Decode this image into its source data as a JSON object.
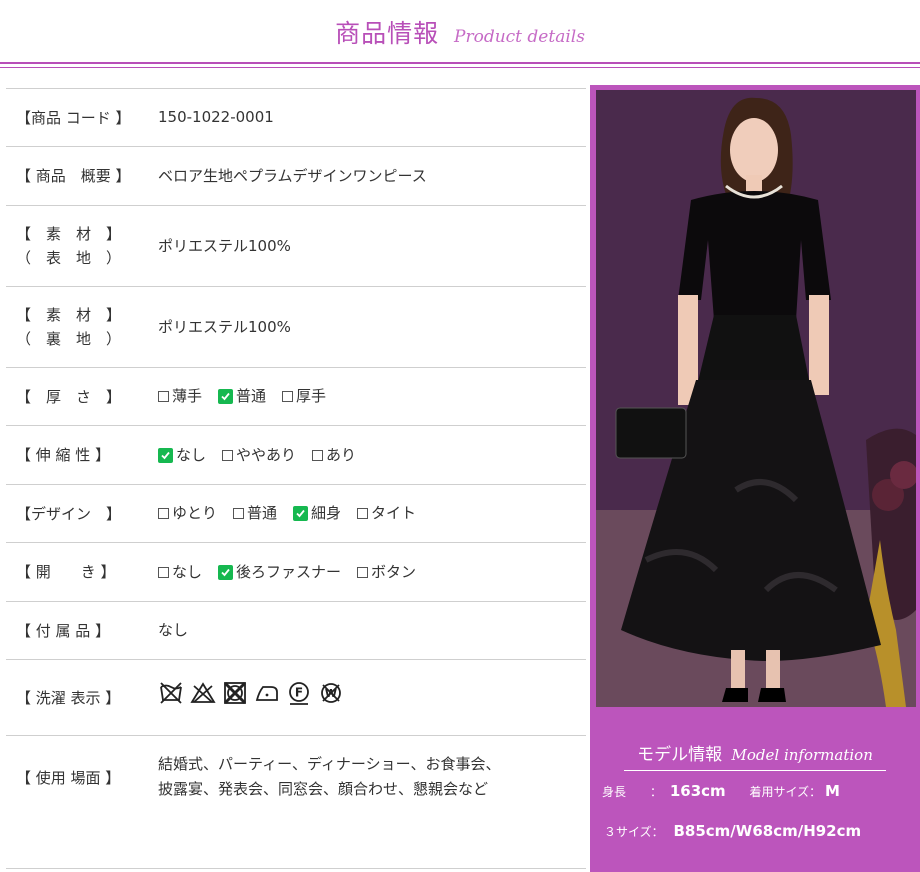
{
  "header": {
    "title_jp": "商品情報",
    "title_en": "Product details"
  },
  "rows": [
    {
      "label": [
        "【商品 コード 】"
      ],
      "value": "150-1022-0001"
    },
    {
      "label": [
        "【 商品　概要 】"
      ],
      "value": "ベロア生地ペプラムデザインワンピース"
    },
    {
      "label": [
        "【　素　材　】",
        "（　表　地　）"
      ],
      "value": "ポリエステル100%"
    },
    {
      "label": [
        "【　素　材　】",
        "（　裏　地　）"
      ],
      "value": "ポリエステル100%"
    },
    {
      "label": [
        "【　厚　さ　】"
      ],
      "options": [
        {
          "text": "薄手",
          "checked": false
        },
        {
          "text": "普通",
          "checked": true
        },
        {
          "text": "厚手",
          "checked": false
        }
      ]
    },
    {
      "label": [
        "【 伸 縮 性 】"
      ],
      "options": [
        {
          "text": "なし",
          "checked": true
        },
        {
          "text": "ややあり",
          "checked": false
        },
        {
          "text": "あり",
          "checked": false
        }
      ]
    },
    {
      "label": [
        "【デザイン　】"
      ],
      "options": [
        {
          "text": "ゆとり",
          "checked": false
        },
        {
          "text": "普通",
          "checked": false
        },
        {
          "text": "細身",
          "checked": true
        },
        {
          "text": "タイト",
          "checked": false
        }
      ]
    },
    {
      "label": [
        "【 開　　き 】"
      ],
      "options": [
        {
          "text": "なし",
          "checked": false
        },
        {
          "text": "後ろファスナー",
          "checked": true
        },
        {
          "text": "ボタン",
          "checked": false
        }
      ]
    },
    {
      "label": [
        "【 付 属 品 】"
      ],
      "value": "なし"
    },
    {
      "label": [
        "【 洗濯 表示 】"
      ],
      "wash_icons": [
        "no-wash-icon",
        "no-bleach-icon",
        "no-tumble-dry-icon",
        "iron-low-icon",
        "dry-clean-f-icon",
        "no-wet-clean-icon"
      ]
    },
    {
      "label": [
        "【 使用 場面 】"
      ],
      "value_lines": [
        "結婚式、パーティー、ディナーショー、お食事会、",
        "披露宴、発表会、同窓会、顔合わせ、懇親会など"
      ]
    }
  ],
  "model": {
    "title_jp": "モデル情報",
    "title_en": "Model information",
    "height_label": "身長　　：",
    "height_value": "163cm",
    "size_label": "着用サイズ：",
    "size_value": "M",
    "three_size_label": "３サイズ：",
    "three_size_value": "B85cm/W68cm/H92cm"
  },
  "colors": {
    "accent": "#b84fb8",
    "check": "#16b850",
    "panel": "#bc55bc"
  }
}
